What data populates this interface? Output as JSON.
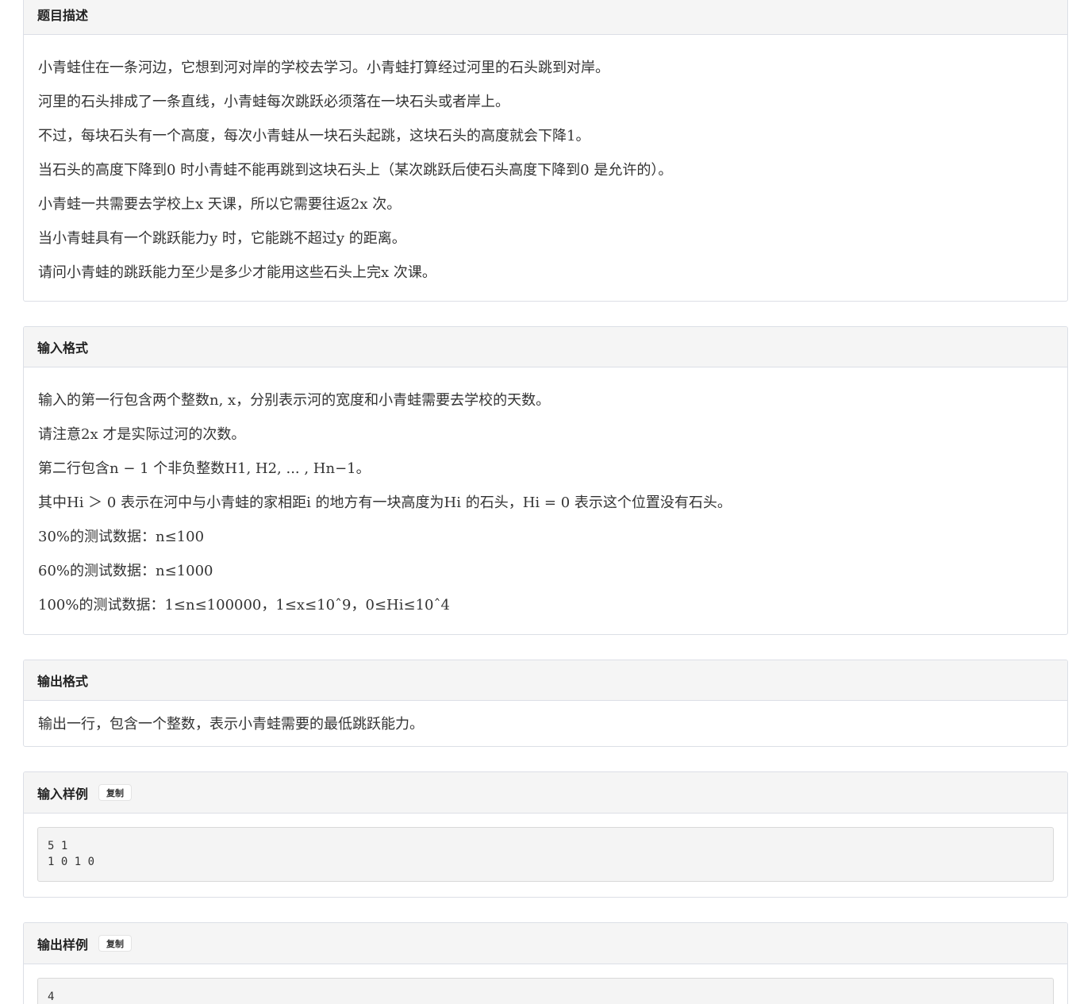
{
  "sections": {
    "description": {
      "title": "题目描述",
      "lines": [
        "小青蛙住在一条河边，它想到河对岸的学校去学习。小青蛙打算经过河里的石头跳到对岸。",
        "河里的石头排成了一条直线，小青蛙每次跳跃必须落在一块石头或者岸上。",
        "不过，每块石头有一个高度，每次小青蛙从一块石头起跳，这块石头的高度就会下降1。",
        "当石头的高度下降到0 时小青蛙不能再跳到这块石头上（某次跳跃后使石头高度下降到0 是允许的）。",
        "小青蛙一共需要去学校上x 天课，所以它需要往返2x 次。",
        "当小青蛙具有一个跳跃能力y 时，它能跳不超过y 的距离。",
        "请问小青蛙的跳跃能力至少是多少才能用这些石头上完x 次课。"
      ]
    },
    "input_format": {
      "title": "输入格式",
      "lines": [
        "输入的第一行包含两个整数n, x，分别表示河的宽度和小青蛙需要去学校的天数。",
        "请注意2x 才是实际过河的次数。",
        "第二行包含n − 1 个非负整数H1, H2, ... , Hn−1。",
        "其中Hi ＞ 0 表示在河中与小青蛙的家相距i 的地方有一块高度为Hi 的石头，Hi = 0 表示这个位置没有石头。",
        "30%的测试数据：n≤100",
        "60%的测试数据：n≤1000",
        "100%的测试数据：1≤n≤100000，1≤x≤10ˆ9，0≤Hi≤10ˆ4"
      ]
    },
    "output_format": {
      "title": "输出格式",
      "lines": [
        "输出一行，包含一个整数，表示小青蛙需要的最低跳跃能力。"
      ]
    },
    "sample_input": {
      "title": "输入样例",
      "copy_label": "复制",
      "code": "5 1\n1 0 1 0"
    },
    "sample_output": {
      "title": "输出样例",
      "copy_label": "复制",
      "code": "4"
    }
  }
}
